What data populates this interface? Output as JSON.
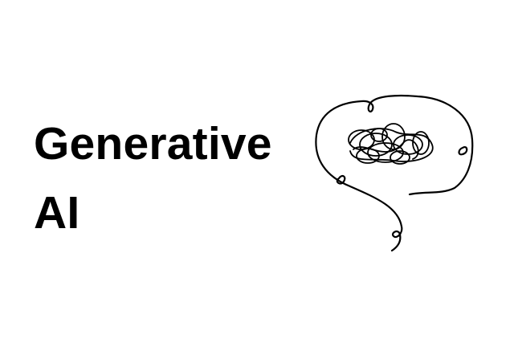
{
  "heading": {
    "line1": "Generative",
    "line2": "AI"
  },
  "illustration": {
    "icon": "scribbled-brain-icon",
    "stroke_color": "#000000"
  },
  "colors": {
    "background": "#ffffff",
    "text": "#000000"
  }
}
